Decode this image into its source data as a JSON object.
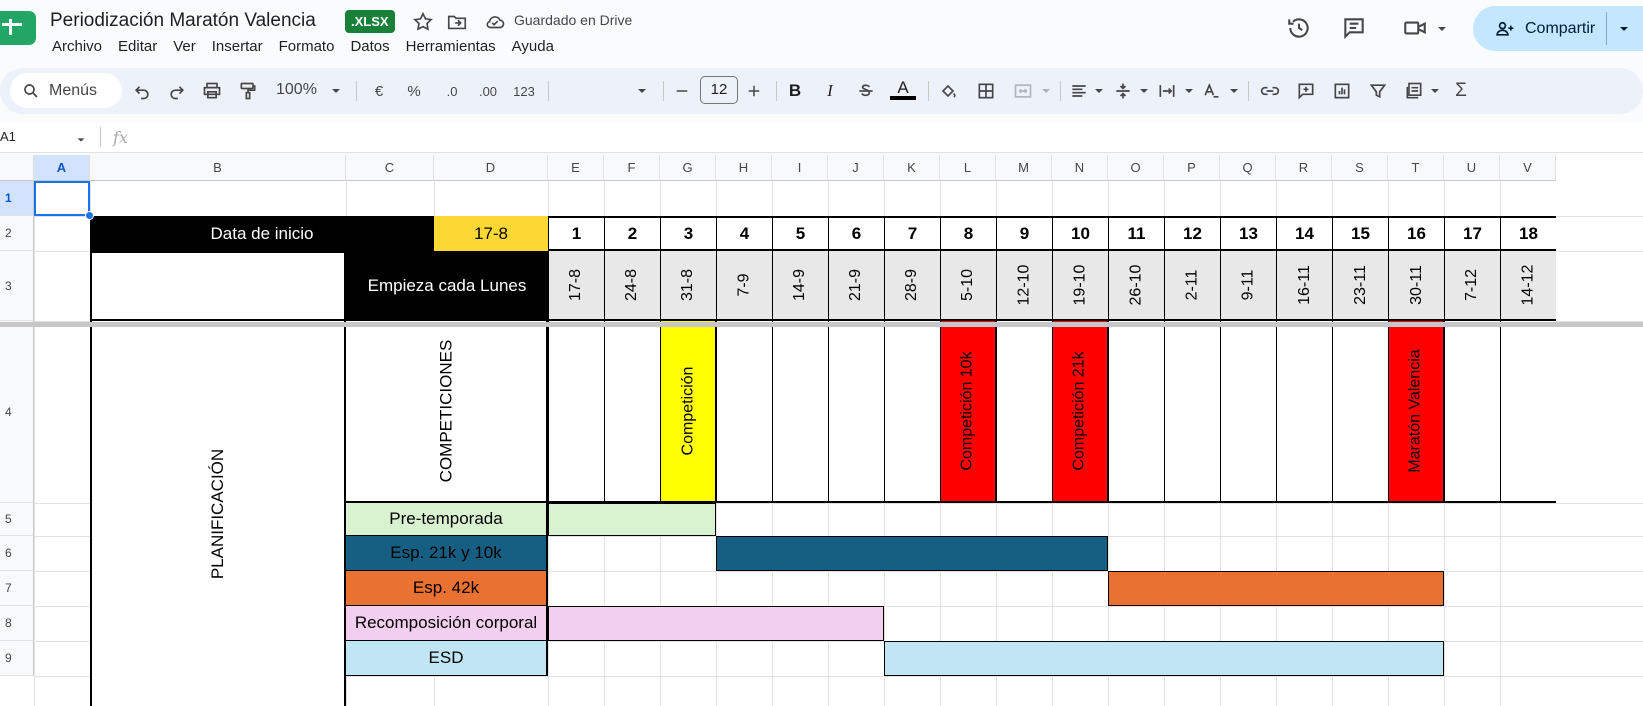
{
  "app": {
    "doc_title": "Periodización Maratón Valencia",
    "file_badge": ".XLSX",
    "saved_status": "Guardado en Drive",
    "share_label": "Compartir"
  },
  "menu": [
    "Archivo",
    "Editar",
    "Ver",
    "Insertar",
    "Formato",
    "Datos",
    "Herramientas",
    "Ayuda"
  ],
  "toolbar": {
    "search_label": "Menús",
    "zoom": "100%",
    "currency": "€",
    "percent": "%",
    "dec_less": ".0",
    "dec_more": ".00",
    "format_123": "123",
    "font_size": "12",
    "bold": "B",
    "italic": "I",
    "textcolor": "A"
  },
  "formula_bar": {
    "name_box": "A1",
    "fx": "fx"
  },
  "columns": [
    "A",
    "B",
    "C",
    "D",
    "E",
    "F",
    "G",
    "H",
    "I",
    "J",
    "K",
    "L",
    "M",
    "N",
    "O",
    "P",
    "Q",
    "R",
    "S",
    "T",
    "U",
    "V"
  ],
  "rows": [
    "1",
    "2",
    "3",
    "4",
    "5",
    "6",
    "7",
    "8",
    "9"
  ],
  "sheet": {
    "start_label": "Data de inicio",
    "start_value": "17-8",
    "weekly_label": "Empieza cada Lunes",
    "weeks": [
      "1",
      "2",
      "3",
      "4",
      "5",
      "6",
      "7",
      "8",
      "9",
      "10",
      "11",
      "12",
      "13",
      "14",
      "15",
      "16",
      "17",
      "18"
    ],
    "dates": [
      "17-8",
      "24-8",
      "31-8",
      "7-9",
      "14-9",
      "21-9",
      "28-9",
      "5-10",
      "12-10",
      "19-10",
      "26-10",
      "2-11",
      "9-11",
      "16-11",
      "23-11",
      "30-11",
      "7-12",
      "14-12"
    ],
    "planning_label": "PLANIFICACIÓN",
    "competitions_label": "COMPETICIONES",
    "competitions": [
      {
        "col": "G",
        "label": "Competición",
        "color": "#ffff00"
      },
      {
        "col": "L",
        "label": "Competición 10k",
        "color": "#ff0000"
      },
      {
        "col": "N",
        "label": "Competición 21k",
        "color": "#ff0000"
      },
      {
        "col": "T",
        "label": "Maratón Valencia",
        "color": "#ff0000"
      }
    ],
    "phases": [
      {
        "label": "Pre-temporada",
        "color": "#d9f2d0",
        "text_color": "#000000",
        "from": "E",
        "to": "G"
      },
      {
        "label": "Esp. 21k y 10k",
        "color": "#175f82",
        "text_color": "#000000",
        "from": "H",
        "to": "N"
      },
      {
        "label": "Esp. 42k",
        "color": "#e97132",
        "text_color": "#000000",
        "from": "O",
        "to": "T"
      },
      {
        "label": "Recomposición corporal",
        "color": "#f2ceef",
        "text_color": "#000000",
        "from": "E",
        "to": "J"
      },
      {
        "label": "ESD",
        "color": "#c0e6f5",
        "text_color": "#000000",
        "from": "K",
        "to": "T"
      }
    ],
    "colors": {
      "start_value_bg": "#fdd835",
      "header_bg": "#000000",
      "date_bg": "#e8e8e8"
    }
  }
}
